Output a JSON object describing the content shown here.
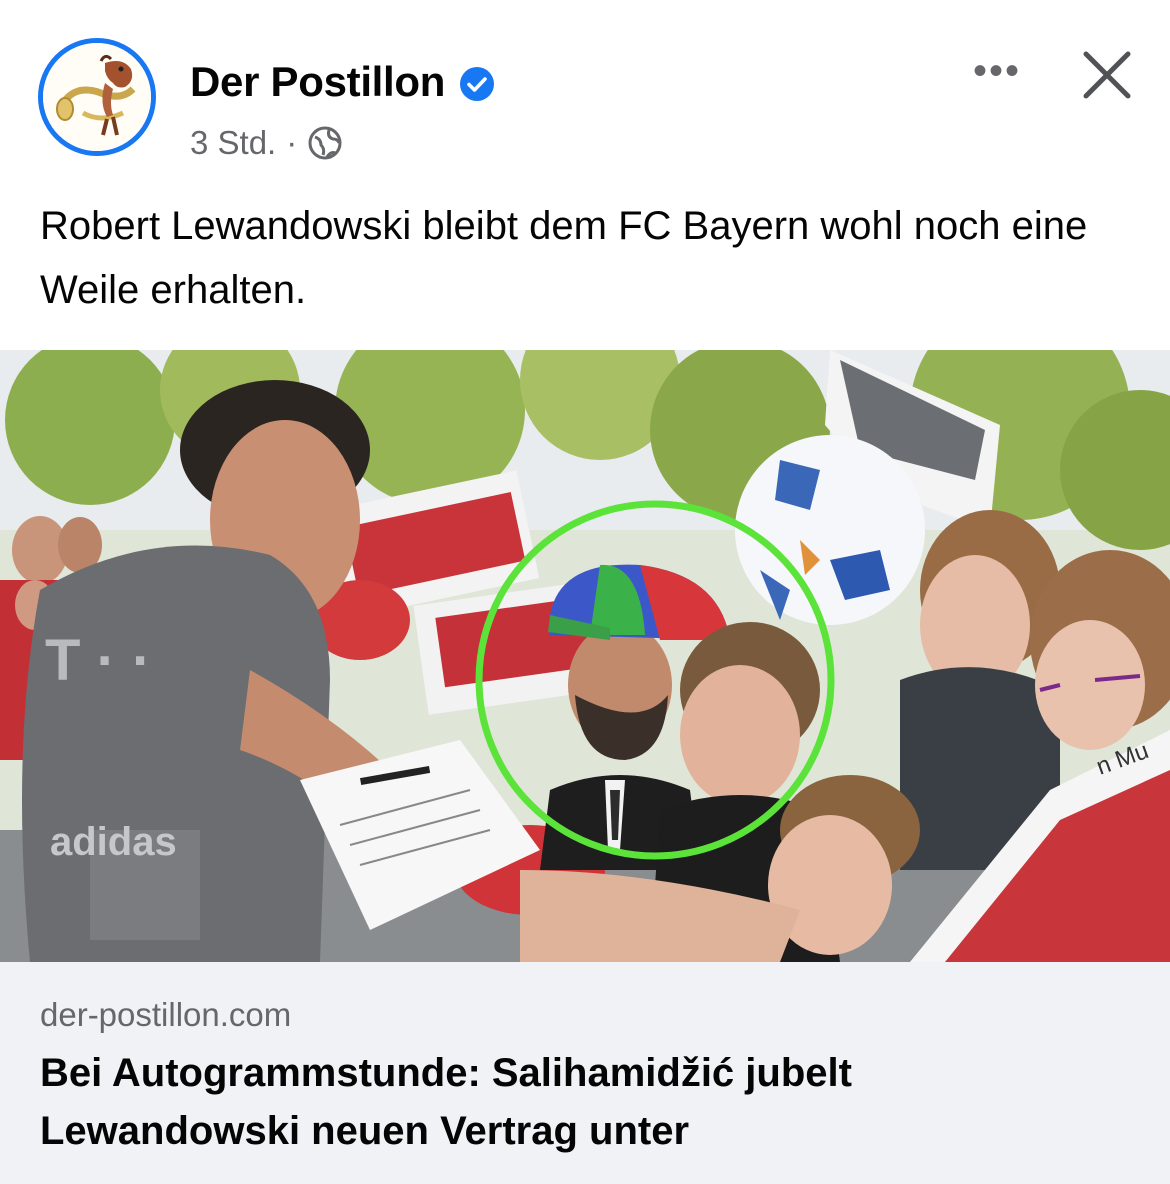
{
  "post": {
    "page_name": "Der Postillon",
    "verified_icon": "verified-badge-icon",
    "time": "3 Std.",
    "separator": "·",
    "audience_icon": "globe-icon",
    "more_icon": "more-options-icon",
    "more_label": "•••",
    "close_icon": "close-icon",
    "text": "Robert Lewandowski bleibt dem FC Bayern wohl noch eine Weile erhalten."
  },
  "photo": {
    "shirt_text_1": "T · ·",
    "shirt_text_2": "adidas",
    "sign_text": "n Mu",
    "highlight_color": "#5be33a"
  },
  "link_preview": {
    "domain": "der-postillon.com",
    "headline": "Bei Autogrammstunde: Salihamidžić jubelt Lewandowski neuen Vertrag unter"
  },
  "colors": {
    "accent": "#1877f2",
    "secondary_text": "#65676b",
    "preview_bg": "#f0f2f5"
  }
}
